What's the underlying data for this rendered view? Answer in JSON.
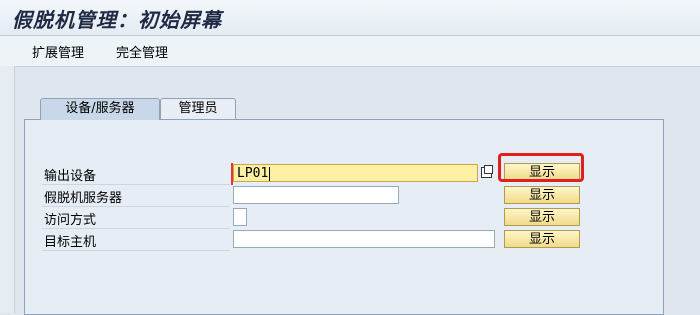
{
  "title": "假脱机管理：初始屏幕",
  "menu": [
    "扩展管理",
    "完全管理"
  ],
  "tabs": [
    {
      "label": "设备/服务器",
      "active": true
    },
    {
      "label": "管理员",
      "active": false
    }
  ],
  "form": {
    "rows": [
      {
        "label": "输出设备",
        "value": "LP01",
        "button": "显示"
      },
      {
        "label": "假脱机服务器",
        "value": "",
        "button": "显示"
      },
      {
        "label": "访问方式",
        "value": "",
        "button": "显示"
      },
      {
        "label": "目标主机",
        "value": "",
        "button": "显示"
      }
    ]
  }
}
